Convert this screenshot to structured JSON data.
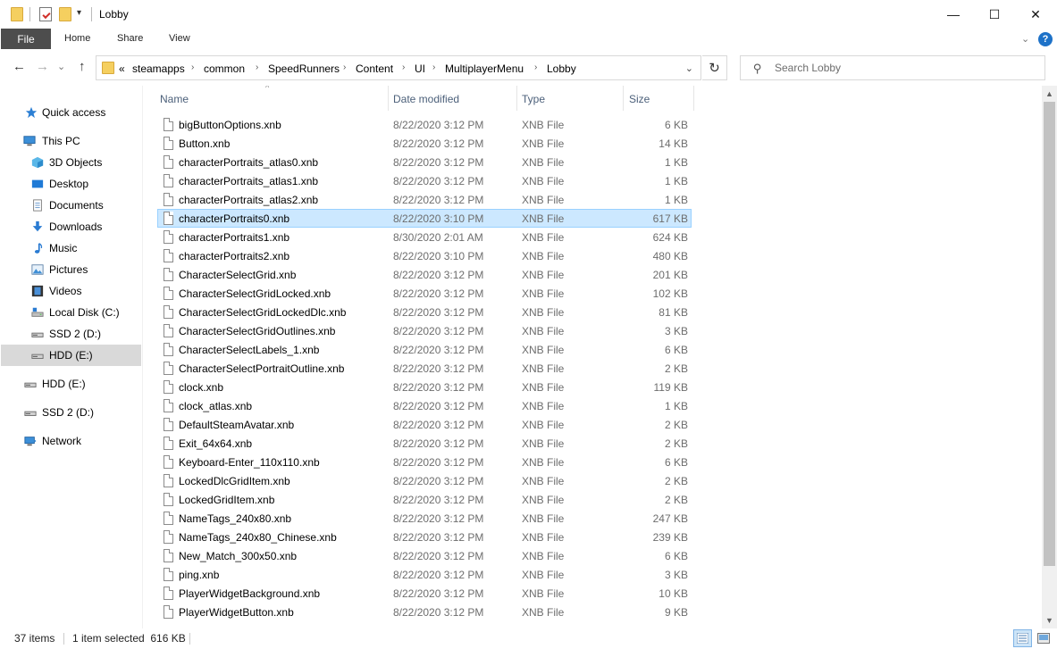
{
  "window": {
    "title": "Lobby"
  },
  "title_bar": {
    "minimize_glyph": "—",
    "maximize_glyph": "☐",
    "close_glyph": "✕",
    "qat_dropdown_glyph": "▾"
  },
  "ribbon": {
    "file_tab": "File",
    "tabs": [
      "Home",
      "Share",
      "View"
    ],
    "expand_glyph": "⌄",
    "help_glyph": "?"
  },
  "navigation": {
    "back_glyph": "←",
    "forward_glyph": "→",
    "recent_glyph": "⌄",
    "up_glyph": "↑",
    "refresh_glyph": "↻"
  },
  "address_bar": {
    "overflow": "«",
    "crumbs": [
      "steamapps",
      "common",
      "SpeedRunners",
      "Content",
      "UI",
      "MultiplayerMenu",
      "Lobby"
    ],
    "separator": "›",
    "dropdown_glyph": "⌄"
  },
  "search": {
    "placeholder": "Search Lobby",
    "value": ""
  },
  "sidebar": {
    "items": [
      {
        "label": "Quick access",
        "icon": "quick-access-star-icon"
      },
      {
        "label": "This PC",
        "icon": "this-pc-icon"
      },
      {
        "label": "3D Objects",
        "icon": "3d-objects-icon"
      },
      {
        "label": "Desktop",
        "icon": "desktop-icon"
      },
      {
        "label": "Documents",
        "icon": "documents-icon"
      },
      {
        "label": "Downloads",
        "icon": "downloads-icon"
      },
      {
        "label": "Music",
        "icon": "music-icon"
      },
      {
        "label": "Pictures",
        "icon": "pictures-icon"
      },
      {
        "label": "Videos",
        "icon": "videos-icon"
      },
      {
        "label": "Local Disk (C:)",
        "icon": "local-disk-icon"
      },
      {
        "label": "SSD 2 (D:)",
        "icon": "drive-icon"
      },
      {
        "label": "HDD (E:)",
        "icon": "drive-icon",
        "selected": true
      },
      {
        "label": "HDD (E:)",
        "icon": "drive-icon"
      },
      {
        "label": "SSD 2 (D:)",
        "icon": "drive-icon"
      },
      {
        "label": "Network",
        "icon": "network-icon"
      }
    ]
  },
  "columns": {
    "name": "Name",
    "date_modified": "Date modified",
    "type": "Type",
    "size": "Size",
    "sort_glyph": "^"
  },
  "files": [
    {
      "name": "bigButtonOptions.xnb",
      "date": "8/22/2020 3:12 PM",
      "type": "XNB File",
      "size": "6 KB"
    },
    {
      "name": "Button.xnb",
      "date": "8/22/2020 3:12 PM",
      "type": "XNB File",
      "size": "14 KB"
    },
    {
      "name": "characterPortraits_atlas0.xnb",
      "date": "8/22/2020 3:12 PM",
      "type": "XNB File",
      "size": "1 KB"
    },
    {
      "name": "characterPortraits_atlas1.xnb",
      "date": "8/22/2020 3:12 PM",
      "type": "XNB File",
      "size": "1 KB"
    },
    {
      "name": "characterPortraits_atlas2.xnb",
      "date": "8/22/2020 3:12 PM",
      "type": "XNB File",
      "size": "1 KB"
    },
    {
      "name": "characterPortraits0.xnb",
      "date": "8/22/2020 3:10 PM",
      "type": "XNB File",
      "size": "617 KB",
      "selected": true
    },
    {
      "name": "characterPortraits1.xnb",
      "date": "8/30/2020 2:01 AM",
      "type": "XNB File",
      "size": "624 KB"
    },
    {
      "name": "characterPortraits2.xnb",
      "date": "8/22/2020 3:10 PM",
      "type": "XNB File",
      "size": "480 KB"
    },
    {
      "name": "CharacterSelectGrid.xnb",
      "date": "8/22/2020 3:12 PM",
      "type": "XNB File",
      "size": "201 KB"
    },
    {
      "name": "CharacterSelectGridLocked.xnb",
      "date": "8/22/2020 3:12 PM",
      "type": "XNB File",
      "size": "102 KB"
    },
    {
      "name": "CharacterSelectGridLockedDlc.xnb",
      "date": "8/22/2020 3:12 PM",
      "type": "XNB File",
      "size": "81 KB"
    },
    {
      "name": "CharacterSelectGridOutlines.xnb",
      "date": "8/22/2020 3:12 PM",
      "type": "XNB File",
      "size": "3 KB"
    },
    {
      "name": "CharacterSelectLabels_1.xnb",
      "date": "8/22/2020 3:12 PM",
      "type": "XNB File",
      "size": "6 KB"
    },
    {
      "name": "CharacterSelectPortraitOutline.xnb",
      "date": "8/22/2020 3:12 PM",
      "type": "XNB File",
      "size": "2 KB"
    },
    {
      "name": "clock.xnb",
      "date": "8/22/2020 3:12 PM",
      "type": "XNB File",
      "size": "119 KB"
    },
    {
      "name": "clock_atlas.xnb",
      "date": "8/22/2020 3:12 PM",
      "type": "XNB File",
      "size": "1 KB"
    },
    {
      "name": "DefaultSteamAvatar.xnb",
      "date": "8/22/2020 3:12 PM",
      "type": "XNB File",
      "size": "2 KB"
    },
    {
      "name": "Exit_64x64.xnb",
      "date": "8/22/2020 3:12 PM",
      "type": "XNB File",
      "size": "2 KB"
    },
    {
      "name": "Keyboard-Enter_110x110.xnb",
      "date": "8/22/2020 3:12 PM",
      "type": "XNB File",
      "size": "6 KB"
    },
    {
      "name": "LockedDlcGridItem.xnb",
      "date": "8/22/2020 3:12 PM",
      "type": "XNB File",
      "size": "2 KB"
    },
    {
      "name": "LockedGridItem.xnb",
      "date": "8/22/2020 3:12 PM",
      "type": "XNB File",
      "size": "2 KB"
    },
    {
      "name": "NameTags_240x80.xnb",
      "date": "8/22/2020 3:12 PM",
      "type": "XNB File",
      "size": "247 KB"
    },
    {
      "name": "NameTags_240x80_Chinese.xnb",
      "date": "8/22/2020 3:12 PM",
      "type": "XNB File",
      "size": "239 KB"
    },
    {
      "name": "New_Match_300x50.xnb",
      "date": "8/22/2020 3:12 PM",
      "type": "XNB File",
      "size": "6 KB"
    },
    {
      "name": "ping.xnb",
      "date": "8/22/2020 3:12 PM",
      "type": "XNB File",
      "size": "3 KB"
    },
    {
      "name": "PlayerWidgetBackground.xnb",
      "date": "8/22/2020 3:12 PM",
      "type": "XNB File",
      "size": "10 KB"
    },
    {
      "name": "PlayerWidgetButton.xnb",
      "date": "8/22/2020 3:12 PM",
      "type": "XNB File",
      "size": "9 KB"
    }
  ],
  "scrollbar": {
    "up_glyph": "▲",
    "down_glyph": "▼"
  },
  "status_bar": {
    "item_count": "37 items",
    "selection": "1 item selected  616 KB"
  }
}
